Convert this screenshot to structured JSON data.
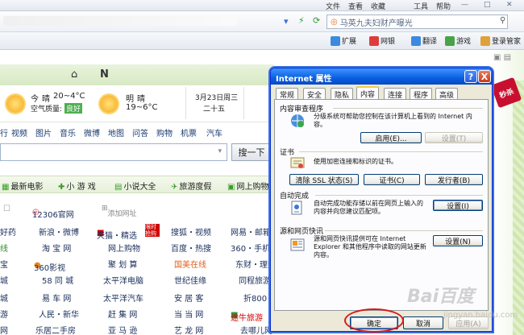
{
  "menubar": {
    "items": [
      "文件",
      "查看",
      "收藏",
      "工具",
      "帮助"
    ]
  },
  "toolbar": {
    "search_text": "马英九夫妇财产曝光",
    "buttons": [
      "扩展",
      "网银",
      "翻译",
      "游戏",
      "登录管家"
    ]
  },
  "page": {
    "nav_icons": [
      "N"
    ],
    "weather": {
      "today_label": "今",
      "today_cond": "晴",
      "today_temp": "20~4°C",
      "air_label": "空气质量:",
      "air_value": "良好",
      "tomorrow_label": "明",
      "tomorrow_cond": "晴",
      "tomorrow_temp": "19~6°C",
      "date": "3月23日周三",
      "lunar": "二十五"
    },
    "categories": [
      "行",
      "视频",
      "图片",
      "音乐",
      "微博",
      "地图",
      "问答",
      "购物",
      "机票",
      "汽车"
    ],
    "search_button": "搜一下",
    "tabs": [
      "最新电影",
      "小 游 戏",
      "小说大全",
      "旅游度假",
      "网上购物"
    ],
    "row0": {
      "a": "12306官网",
      "b": "添加网址"
    },
    "rows": [
      [
        "好药",
        "新浪・微博",
        "天猫・精选",
        "限时抢购",
        "搜狐・视频",
        "网易・邮箱"
      ],
      [
        "线",
        "淘 宝 网",
        "网上购物",
        "",
        "百度・热搜",
        "360・手机"
      ],
      [
        "宝",
        "360影视",
        "聚 划 算",
        "",
        "国美在线",
        "东财・理财"
      ],
      [
        "城",
        "58 同 城",
        "太平洋电脑",
        "",
        "世纪佳缘",
        "同程旅游"
      ],
      [
        "城",
        "易 车 网",
        "太平洋汽车",
        "",
        "安 居 客",
        "折800"
      ],
      [
        "游",
        "人民・新华",
        "赶 集 网",
        "",
        "当 当 网",
        "途牛旅游"
      ],
      [
        "网",
        "乐居二手房",
        "亚 马 逊",
        "",
        "艺 龙 网",
        "去哪儿网"
      ]
    ],
    "seckill": "秒杀"
  },
  "dialog": {
    "title": "Internet 属性",
    "help": "?",
    "close": "X",
    "tabs": [
      "常规",
      "安全",
      "隐私",
      "内容",
      "连接",
      "程序",
      "高级"
    ],
    "active_tab": "内容",
    "content_advisor": {
      "label": "内容审查程序",
      "desc": "分级系统可帮助您控制在该计算机上看到的 Internet 内容。",
      "enable": "启用(E)...",
      "settings": "设置(T)"
    },
    "certificates": {
      "label": "证书",
      "desc": "使用加密连接和标识的证书。",
      "clear_ssl": "清除 SSL 状态(S)",
      "certs": "证书(C)",
      "publishers": "发行者(B)"
    },
    "autocomplete": {
      "label": "自动完成",
      "desc": "自动完成功能存储以前在网页上输入的内容并向您建议匹配项。",
      "settings": "设置(I)"
    },
    "feeds": {
      "label": "源和网页快讯",
      "desc": "源和网页快讯提供可在 Internet Explorer 和其他程序中读取的网站更新内容。",
      "settings": "设置(N)"
    },
    "buttons": {
      "ok": "确定",
      "cancel": "取消",
      "apply": "应用(A)"
    }
  },
  "watermark": {
    "main": "Bai百度",
    "sub": "jingyan.baidu.com"
  }
}
